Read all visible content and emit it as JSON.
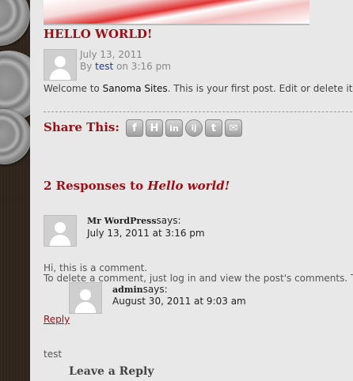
{
  "post": {
    "title": "HELLO WORLD!",
    "date": "July 13, 2011",
    "by_label": "By",
    "author": "test",
    "time": "on 3:16 pm",
    "text_prefix": "Welcome to",
    "site_name": "Sanoma Sites",
    "text_suffix": ". This is your first post. Edit or delete it,"
  },
  "share": {
    "label": "Share This:",
    "icons": [
      {
        "name": "facebook-icon",
        "glyph": "f"
      },
      {
        "name": "hyves-icon",
        "glyph": "H"
      },
      {
        "name": "linkedin-icon",
        "glyph": "in"
      },
      {
        "name": "nujij-icon",
        "glyph": "ij"
      },
      {
        "name": "twitter-icon",
        "glyph": "t"
      },
      {
        "name": "email-icon",
        "glyph": "✉"
      }
    ]
  },
  "responses": {
    "count_text": "2 Responses to",
    "post_title": "Hello world!"
  },
  "comments": [
    {
      "author": "Mr WordPress",
      "says": "says:",
      "date": "July 13, 2011 at 3:16 pm",
      "line1": "Hi, this is a comment.",
      "line2": "To delete a comment, just log in and view the post's comments. T"
    },
    {
      "author": "admin",
      "says": "says:",
      "date": "August 30, 2011 at 9:03 am"
    }
  ],
  "reply_label": "Reply",
  "trailing_text": "test",
  "leave_reply": "Leave a Reply"
}
